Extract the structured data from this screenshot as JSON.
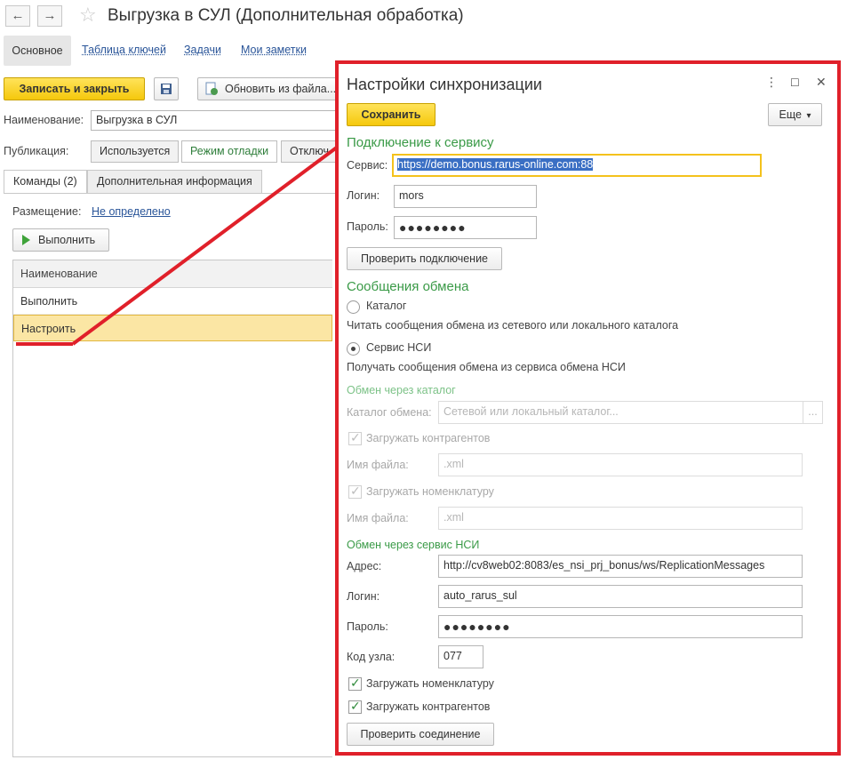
{
  "window": {
    "title": "Выгрузка в СУЛ (Дополнительная обработка)",
    "back_icon": "←",
    "forward_icon": "→",
    "star_icon": "☆"
  },
  "nav_tabs": [
    "Основное",
    "Таблица ключей",
    "Задачи",
    "Мои заметки"
  ],
  "toolbar": {
    "save_close": "Записать и закрыть",
    "refresh_from_file": "Обновить из файла..."
  },
  "form": {
    "name_label": "Наименование:",
    "name_value": "Выгрузка в СУЛ",
    "publication_label": "Публикация:",
    "publication_options": [
      "Используется",
      "Режим отладки",
      "Отключ"
    ]
  },
  "tabs": [
    "Команды (2)",
    "Дополнительная информация"
  ],
  "commands": {
    "placement_label": "Размещение:",
    "placement_value": "Не определено",
    "run_button": "Выполнить",
    "table_header": "Наименование",
    "rows": [
      "Выполнить",
      "Настроить"
    ]
  },
  "dialog": {
    "title": "Настройки синхронизации",
    "save_button": "Сохранить",
    "more_button": "Еще",
    "more_caret": "▾",
    "section_connection": "Подключение к сервису",
    "service_label": "Сервис:",
    "service_value": "https://demo.bonus.rarus-online.com:88",
    "login_label": "Логин:",
    "login_value": "mors",
    "password_label": "Пароль:",
    "password_value": "●●●●●●●●",
    "check_connection": "Проверить подключение",
    "section_messages": "Сообщения обмена",
    "radio_catalog": "Каталог",
    "radio_catalog_desc": "Читать сообщения обмена из сетевого или локального каталога",
    "radio_nsi": "Сервис НСИ",
    "radio_nsi_desc": "Получать сообщения обмена из сервиса обмена НСИ",
    "sub_catalog": "Обмен через каталог",
    "catalog_label": "Каталог обмена:",
    "catalog_placeholder": "Сетевой или локальный каталог...",
    "catalog_select": "...",
    "load_contractors_dim": "Загружать контрагентов",
    "file_name_label": "Имя файла:",
    "file_name_placeholder": ".xml",
    "load_nomenclature_dim": "Загружать номенклатуру",
    "sub_nsi": "Обмен через сервис НСИ",
    "address_label": "Адрес:",
    "address_value": "http://cv8web02:8083/es_nsi_prj_bonus/ws/ReplicationMessages",
    "nsi_login_label": "Логин:",
    "nsi_login_value": "auto_rarus_sul",
    "nsi_password_label": "Пароль:",
    "nsi_password_value": "●●●●●●●●",
    "node_code_label": "Код узла:",
    "node_code_value": "077",
    "load_nomenclature": "Загружать номенклатуру",
    "load_contractors": "Загружать контрагентов",
    "check_link": "Проверить соединение",
    "check_mark": "✓",
    "menu_icon": "⋮",
    "maximize_icon": "☐",
    "close_icon": "✕"
  },
  "colors": {
    "highlight_frame": "#e0202a",
    "accent_yellow": "#f5c80c",
    "section_green": "#3a9a47",
    "link_blue": "#2a5599"
  }
}
